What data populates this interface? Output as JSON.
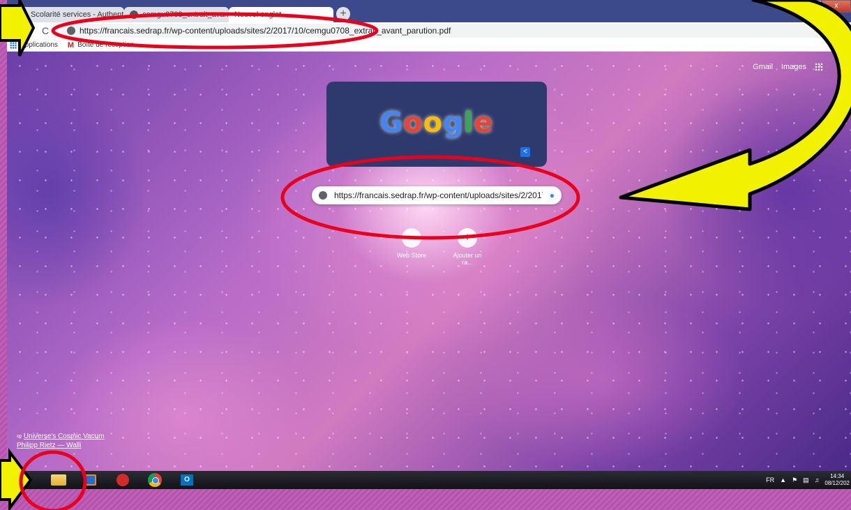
{
  "tabs": [
    {
      "label": "Scolarité services - Authentif",
      "close": "x"
    },
    {
      "label": "cemgu0708_extrait_avant_parutio",
      "close": "x"
    },
    {
      "label": "Nouvel onglet"
    }
  ],
  "newtab": "+",
  "window_buttons": {
    "minimize": "–",
    "maximize": "□",
    "close": "x"
  },
  "toolbar": {
    "back": "←",
    "forward": "→",
    "reload": "C",
    "url": "https://francais.sedrap.fr/wp-content/uploads/sites/2/2017/10/cemgu0708_extrait_avant_parution.pdf",
    "profile": "c"
  },
  "bookmarks": [
    {
      "label": "Applications",
      "icon": "apps-grid-icon"
    },
    {
      "label": "Boîte de réception...",
      "icon": "gmail-icon"
    }
  ],
  "ntp": {
    "gmail": "Gmail",
    "images": "Images",
    "account": "c",
    "doodle_letters": [
      "G",
      "o",
      "o",
      "g",
      "l",
      "e"
    ],
    "doodle_colors": [
      "#4285f4",
      "#ea4335",
      "#fbbc05",
      "#4285f4",
      "#34a853",
      "#ea4335"
    ],
    "search_text": "https://francais.sedrap.fr/wp-content/uploads/sites/2/2017/10/cemg",
    "shortcuts": [
      {
        "label": "Web Store",
        "glyph": ""
      },
      {
        "label": "Ajouter un ra...",
        "glyph": "+"
      }
    ],
    "credit_title": "Universe's Cosmic Vacum",
    "credit_author": "Philipp Rietz — Walli"
  },
  "taskbar": {
    "apps": [
      "internet-explorer",
      "file-explorer",
      "media-player",
      "app-red",
      "chrome",
      "outlook"
    ],
    "language": "FR",
    "time": "14:34",
    "date": "08/12/202"
  },
  "colors": {
    "annotation_red": "#e8001c",
    "arrow_yellow": "#f2f200"
  }
}
